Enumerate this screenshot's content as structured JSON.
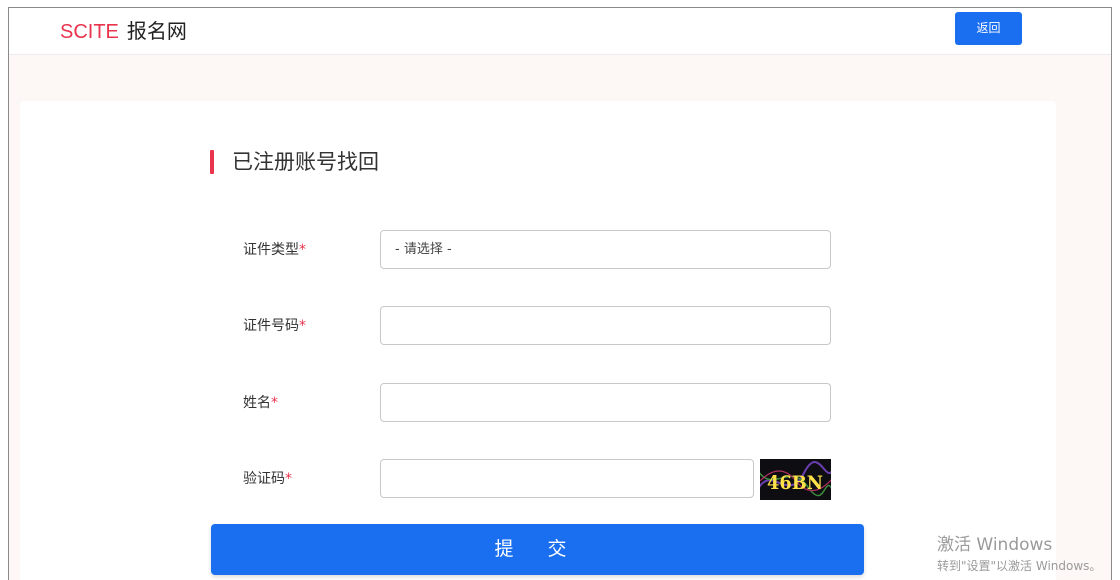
{
  "header": {
    "brand": "SCITE",
    "site_name": "报名网",
    "back_label": "返回"
  },
  "form": {
    "title": "已注册账号找回",
    "required_mark": "*",
    "fields": [
      {
        "label": "证件类型",
        "value": "- 请选择 -"
      },
      {
        "label": "证件号码",
        "value": ""
      },
      {
        "label": "姓名",
        "value": ""
      },
      {
        "label": "验证码",
        "value": ""
      }
    ],
    "captcha_text": "46BN",
    "submit_label": "提 交"
  },
  "watermark": {
    "line1": "激活 Windows",
    "line2": "转到\"设置\"以激活 Windows。"
  },
  "colors": {
    "brand": "#e8344d",
    "primary": "#1a6ff0",
    "page_bg": "#fdf7f5"
  }
}
